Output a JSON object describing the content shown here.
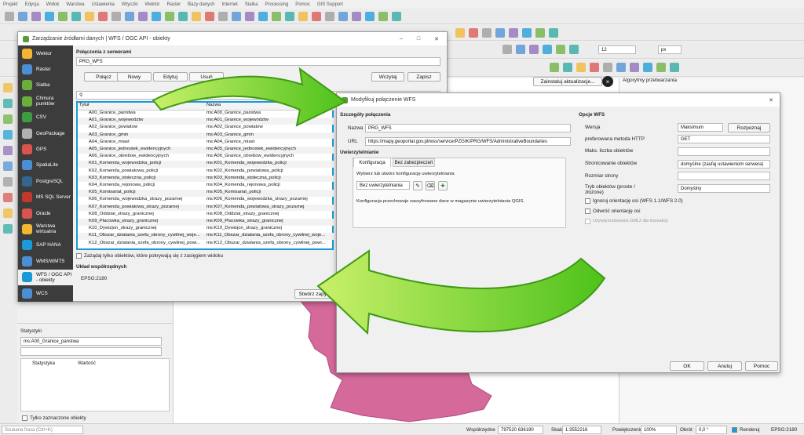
{
  "menubar": [
    "Projekt",
    "Edycja",
    "Widok",
    "Warstwa",
    "Ustawienia",
    "Wtyczki",
    "Wektor",
    "Raster",
    "Bazy danych",
    "Internet",
    "Siatka",
    "Processing",
    "Pomoc",
    "GIS Support"
  ],
  "colors": {
    "accent_blue": "#1a9bd7",
    "sidebar_dark": "#3c3c3c",
    "arrow_green": "#7dd321",
    "polygon_pink": "#d4699a"
  },
  "toolbar2": {
    "scale_value": "12",
    "scale_unit": "px"
  },
  "update_button": "Zainstaluj aktualizacje...",
  "processing_title": "Algorytmy przetwarzania",
  "datasource": {
    "title": "Zarządzanie źródłami danych | WFS / OGC API - obiekty",
    "sidebar": [
      {
        "label": "Wektor",
        "icon": "vector-icon"
      },
      {
        "label": "Raster",
        "icon": "raster-icon"
      },
      {
        "label": "Siatka",
        "icon": "mesh-icon"
      },
      {
        "label": "Chmura punktów",
        "icon": "point-cloud-icon"
      },
      {
        "label": "CSV",
        "icon": "csv-icon"
      },
      {
        "label": "GeoPackage",
        "icon": "geopackage-icon"
      },
      {
        "label": "GPS",
        "icon": "gps-icon"
      },
      {
        "label": "SpatiaLite",
        "icon": "spatialite-icon"
      },
      {
        "label": "PostgreSQL",
        "icon": "postgresql-icon"
      },
      {
        "label": "MS SQL Server",
        "icon": "mssql-icon"
      },
      {
        "label": "Oracle",
        "icon": "oracle-icon"
      },
      {
        "label": "Warstwa wirtualna",
        "icon": "virtual-layer-icon"
      },
      {
        "label": "SAP HANA",
        "icon": "sap-hana-icon"
      },
      {
        "label": "WMS/WMTS",
        "icon": "wms-icon"
      },
      {
        "label": "WFS / OGC API - obiekty",
        "icon": "wfs-icon"
      },
      {
        "label": "WCS",
        "icon": "wcs-icon"
      }
    ],
    "connections_label": "Połączenia z serwerami",
    "connection_value": "PRG_WFS",
    "buttons": {
      "connect": "Połącz",
      "new": "Nowy",
      "edit": "Edytuj",
      "remove": "Usuń",
      "load": "Wczytaj",
      "save": "Zapisz"
    },
    "columns": [
      "Tytuł",
      "Nazwa"
    ],
    "rows": [
      [
        "A00_Granice_panstwa",
        "ms:A00_Granice_panstwa"
      ],
      [
        "A01_Granice_wojewodztw",
        "ms:A01_Granice_wojewodztw"
      ],
      [
        "A02_Granice_powiatow",
        "ms:A02_Granice_powiatow"
      ],
      [
        "A03_Granice_gmin",
        "ms:A03_Granice_gmin"
      ],
      [
        "A04_Granice_miast",
        "ms:A04_Granice_miast"
      ],
      [
        "A05_Granice_jednostek_ewidencyjnych",
        "ms:A05_Granice_jednostek_ewidencyjnych"
      ],
      [
        "A06_Granice_obrebow_ewidencyjnych",
        "ms:A06_Granice_obrebow_ewidencyjnych"
      ],
      [
        "K01_Komenda_wojewodzka_policji",
        "ms:K01_Komenda_wojewodzka_policji"
      ],
      [
        "K02_Komenda_powiatowa_policji",
        "ms:K02_Komenda_powiatowa_policji"
      ],
      [
        "K03_Komenda_stoleczna_policji",
        "ms:K03_Komenda_stoleczna_policji"
      ],
      [
        "K04_Komenda_rejonowa_policji",
        "ms:K04_Komenda_rejonowa_policji"
      ],
      [
        "K05_Komisariat_policji",
        "ms:K05_Komisariat_policji"
      ],
      [
        "K06_Komenda_wojewodzka_strazy_pozarnej",
        "ms:K06_Komenda_wojewodzka_strazy_pozarnej"
      ],
      [
        "K07_Komenda_powiatowa_strazy_pozarnej",
        "ms:K07_Komenda_powiatowa_strazy_pozarnej"
      ],
      [
        "K08_Oddzial_strazy_granicznej",
        "ms:K08_Oddzial_strazy_granicznej"
      ],
      [
        "K09_Placowka_strazy_granicznej",
        "ms:K09_Placowka_strazy_granicznej"
      ],
      [
        "K10_Dywizjon_strazy_granicznej",
        "ms:K10_Dywizjon_strazy_granicznej"
      ],
      [
        "K11_Obszar_dzialania_szefa_obrony_cywilnej_woje...",
        "ms:K11_Obszar_dzialania_szefa_obrony_cywilnej_woje..."
      ],
      [
        "K12_Obszar_dzialania_szefa_obrony_cywilnej_powi...",
        "ms:K12_Obszar_dzialania_szefa_obrony_cywilnej_powi..."
      ]
    ],
    "extent_checkbox": "Zażądaj tylko obiektów, które pokrywają się z zasięgiem widoku",
    "crs_label": "Układ współrzędnych",
    "crs_value": "EPSG:2180",
    "create_button": "Stwórz zapyta"
  },
  "stats": {
    "title": "Statystyki",
    "layer": "ms:A00_Granice_panstwa",
    "col_stat": "Statystyka",
    "col_value": "Wartość",
    "only_selected": "Tylko zaznaczone obiekty"
  },
  "modify": {
    "title": "Modyfikuj połączenie WFS",
    "details_header": "Szczegóły połączenia",
    "name_label": "Nazwa",
    "name_value": "PRG_WFS",
    "url_label": "URL",
    "url_value": "https://mapy.geoportal.gov.pl/wss/service/PZGIK/PRG/WFS/AdministrativeBoundaries",
    "auth_header": "Uwierzytelnianie",
    "tab_config": "Konfiguracja",
    "tab_basic": "Bez zabezpieczeń",
    "auth_prompt": "Wybierz lub utwórz konfigurację uwierzytelniania",
    "auth_select": "Bez uwierzytelniania",
    "auth_note": "Konfiguracja przechowuje zaszyfrowane dane w magazynie uwierzytelniania QGIS.",
    "options_header": "Opcje WFS",
    "version_label": "Wersja",
    "version_value": "Maksimum",
    "detect_button": "Rozpoznaj",
    "http_label": "preferowana metoda HTTP",
    "http_value": "GET",
    "max_label": "Maks. liczba obiektów",
    "paging_label": "Stronicowanie obiektów",
    "paging_value": "domyślne (zaufaj ustawieniom serwera)",
    "pagesize_label": "Rozmiar strony",
    "mode_label": "Tryb obiektów (proste / złożone)",
    "mode_value": "Domyślny",
    "cb_ignore": "Ignoruj orientację osi (WFS 1.1/WFS 2.0)",
    "cb_invert": "Odwróć orientację osi",
    "cb_gml": "Używaj kodowania GML2 dla transakcji",
    "ok": "OK",
    "cancel": "Anuluj",
    "help": "Pomoc"
  },
  "statusbar": {
    "search_placeholder": "Szukana fraza (Ctrl+K)",
    "coord_label": "Współrzędne",
    "coord_value": "797520  636190",
    "scale_label": "Skala",
    "scale_value": "1:3552216",
    "magnifier_label": "Powiększenie",
    "magnifier_value": "100%",
    "rotation_label": "Obrót",
    "rotation_value": "0,0 °",
    "render_label": "Renderuj",
    "crs": "EPSG:2180"
  }
}
